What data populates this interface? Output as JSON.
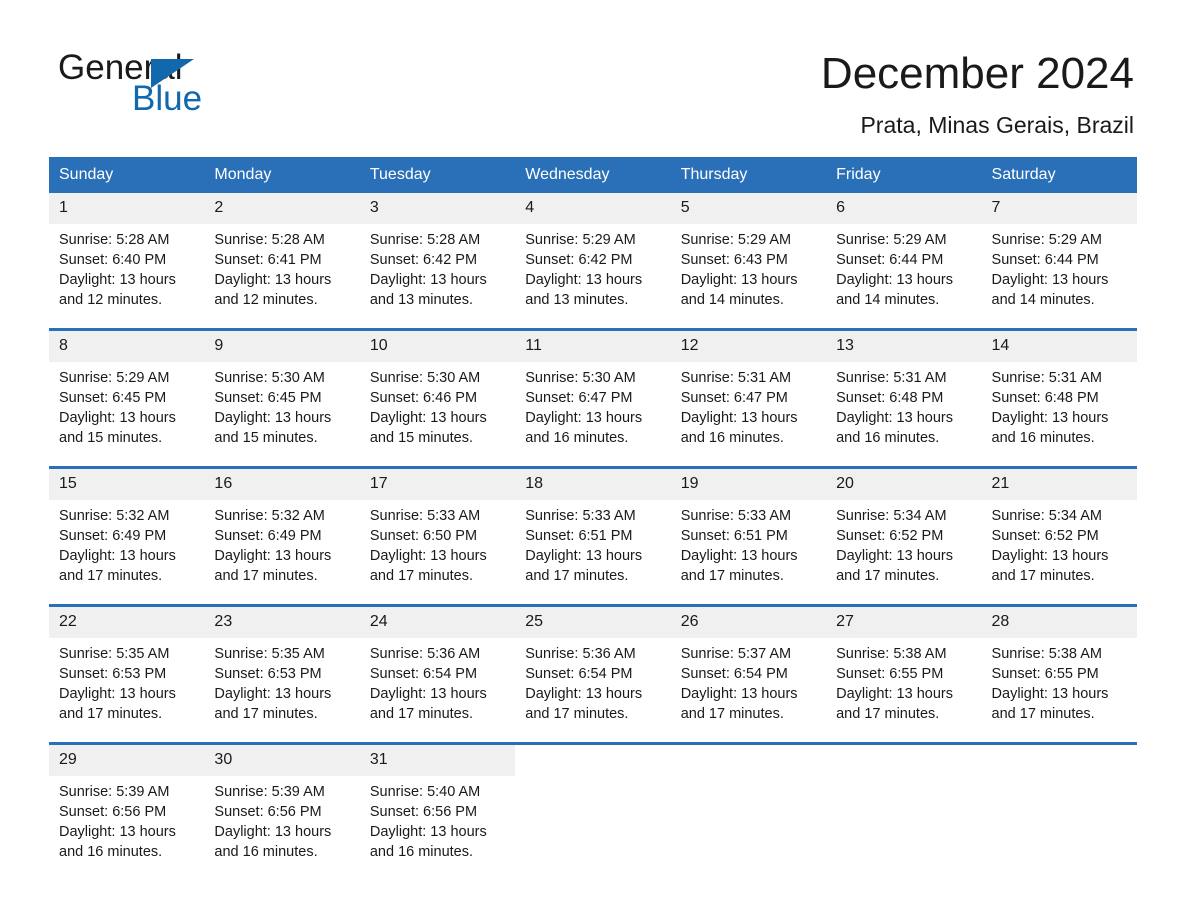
{
  "logo": {
    "word_one": "General",
    "word_two": "Blue",
    "triangle_icon": "triangle-icon",
    "brand_color": "#1168ad"
  },
  "header": {
    "month_title": "December 2024",
    "location": "Prata, Minas Gerais, Brazil"
  },
  "colors": {
    "header_blue": "#2a70b8",
    "daynum_band": "#f0f0f0",
    "text": "#1a1a1a"
  },
  "calendar": {
    "weekday_headers": [
      "Sunday",
      "Monday",
      "Tuesday",
      "Wednesday",
      "Thursday",
      "Friday",
      "Saturday"
    ],
    "weeks": [
      [
        {
          "day": "1",
          "sunrise": "Sunrise: 5:28 AM",
          "sunset": "Sunset: 6:40 PM",
          "daylight_1": "Daylight: 13 hours",
          "daylight_2": "and 12 minutes."
        },
        {
          "day": "2",
          "sunrise": "Sunrise: 5:28 AM",
          "sunset": "Sunset: 6:41 PM",
          "daylight_1": "Daylight: 13 hours",
          "daylight_2": "and 12 minutes."
        },
        {
          "day": "3",
          "sunrise": "Sunrise: 5:28 AM",
          "sunset": "Sunset: 6:42 PM",
          "daylight_1": "Daylight: 13 hours",
          "daylight_2": "and 13 minutes."
        },
        {
          "day": "4",
          "sunrise": "Sunrise: 5:29 AM",
          "sunset": "Sunset: 6:42 PM",
          "daylight_1": "Daylight: 13 hours",
          "daylight_2": "and 13 minutes."
        },
        {
          "day": "5",
          "sunrise": "Sunrise: 5:29 AM",
          "sunset": "Sunset: 6:43 PM",
          "daylight_1": "Daylight: 13 hours",
          "daylight_2": "and 14 minutes."
        },
        {
          "day": "6",
          "sunrise": "Sunrise: 5:29 AM",
          "sunset": "Sunset: 6:44 PM",
          "daylight_1": "Daylight: 13 hours",
          "daylight_2": "and 14 minutes."
        },
        {
          "day": "7",
          "sunrise": "Sunrise: 5:29 AM",
          "sunset": "Sunset: 6:44 PM",
          "daylight_1": "Daylight: 13 hours",
          "daylight_2": "and 14 minutes."
        }
      ],
      [
        {
          "day": "8",
          "sunrise": "Sunrise: 5:29 AM",
          "sunset": "Sunset: 6:45 PM",
          "daylight_1": "Daylight: 13 hours",
          "daylight_2": "and 15 minutes."
        },
        {
          "day": "9",
          "sunrise": "Sunrise: 5:30 AM",
          "sunset": "Sunset: 6:45 PM",
          "daylight_1": "Daylight: 13 hours",
          "daylight_2": "and 15 minutes."
        },
        {
          "day": "10",
          "sunrise": "Sunrise: 5:30 AM",
          "sunset": "Sunset: 6:46 PM",
          "daylight_1": "Daylight: 13 hours",
          "daylight_2": "and 15 minutes."
        },
        {
          "day": "11",
          "sunrise": "Sunrise: 5:30 AM",
          "sunset": "Sunset: 6:47 PM",
          "daylight_1": "Daylight: 13 hours",
          "daylight_2": "and 16 minutes."
        },
        {
          "day": "12",
          "sunrise": "Sunrise: 5:31 AM",
          "sunset": "Sunset: 6:47 PM",
          "daylight_1": "Daylight: 13 hours",
          "daylight_2": "and 16 minutes."
        },
        {
          "day": "13",
          "sunrise": "Sunrise: 5:31 AM",
          "sunset": "Sunset: 6:48 PM",
          "daylight_1": "Daylight: 13 hours",
          "daylight_2": "and 16 minutes."
        },
        {
          "day": "14",
          "sunrise": "Sunrise: 5:31 AM",
          "sunset": "Sunset: 6:48 PM",
          "daylight_1": "Daylight: 13 hours",
          "daylight_2": "and 16 minutes."
        }
      ],
      [
        {
          "day": "15",
          "sunrise": "Sunrise: 5:32 AM",
          "sunset": "Sunset: 6:49 PM",
          "daylight_1": "Daylight: 13 hours",
          "daylight_2": "and 17 minutes."
        },
        {
          "day": "16",
          "sunrise": "Sunrise: 5:32 AM",
          "sunset": "Sunset: 6:49 PM",
          "daylight_1": "Daylight: 13 hours",
          "daylight_2": "and 17 minutes."
        },
        {
          "day": "17",
          "sunrise": "Sunrise: 5:33 AM",
          "sunset": "Sunset: 6:50 PM",
          "daylight_1": "Daylight: 13 hours",
          "daylight_2": "and 17 minutes."
        },
        {
          "day": "18",
          "sunrise": "Sunrise: 5:33 AM",
          "sunset": "Sunset: 6:51 PM",
          "daylight_1": "Daylight: 13 hours",
          "daylight_2": "and 17 minutes."
        },
        {
          "day": "19",
          "sunrise": "Sunrise: 5:33 AM",
          "sunset": "Sunset: 6:51 PM",
          "daylight_1": "Daylight: 13 hours",
          "daylight_2": "and 17 minutes."
        },
        {
          "day": "20",
          "sunrise": "Sunrise: 5:34 AM",
          "sunset": "Sunset: 6:52 PM",
          "daylight_1": "Daylight: 13 hours",
          "daylight_2": "and 17 minutes."
        },
        {
          "day": "21",
          "sunrise": "Sunrise: 5:34 AM",
          "sunset": "Sunset: 6:52 PM",
          "daylight_1": "Daylight: 13 hours",
          "daylight_2": "and 17 minutes."
        }
      ],
      [
        {
          "day": "22",
          "sunrise": "Sunrise: 5:35 AM",
          "sunset": "Sunset: 6:53 PM",
          "daylight_1": "Daylight: 13 hours",
          "daylight_2": "and 17 minutes."
        },
        {
          "day": "23",
          "sunrise": "Sunrise: 5:35 AM",
          "sunset": "Sunset: 6:53 PM",
          "daylight_1": "Daylight: 13 hours",
          "daylight_2": "and 17 minutes."
        },
        {
          "day": "24",
          "sunrise": "Sunrise: 5:36 AM",
          "sunset": "Sunset: 6:54 PM",
          "daylight_1": "Daylight: 13 hours",
          "daylight_2": "and 17 minutes."
        },
        {
          "day": "25",
          "sunrise": "Sunrise: 5:36 AM",
          "sunset": "Sunset: 6:54 PM",
          "daylight_1": "Daylight: 13 hours",
          "daylight_2": "and 17 minutes."
        },
        {
          "day": "26",
          "sunrise": "Sunrise: 5:37 AM",
          "sunset": "Sunset: 6:54 PM",
          "daylight_1": "Daylight: 13 hours",
          "daylight_2": "and 17 minutes."
        },
        {
          "day": "27",
          "sunrise": "Sunrise: 5:38 AM",
          "sunset": "Sunset: 6:55 PM",
          "daylight_1": "Daylight: 13 hours",
          "daylight_2": "and 17 minutes."
        },
        {
          "day": "28",
          "sunrise": "Sunrise: 5:38 AM",
          "sunset": "Sunset: 6:55 PM",
          "daylight_1": "Daylight: 13 hours",
          "daylight_2": "and 17 minutes."
        }
      ],
      [
        {
          "day": "29",
          "sunrise": "Sunrise: 5:39 AM",
          "sunset": "Sunset: 6:56 PM",
          "daylight_1": "Daylight: 13 hours",
          "daylight_2": "and 16 minutes."
        },
        {
          "day": "30",
          "sunrise": "Sunrise: 5:39 AM",
          "sunset": "Sunset: 6:56 PM",
          "daylight_1": "Daylight: 13 hours",
          "daylight_2": "and 16 minutes."
        },
        {
          "day": "31",
          "sunrise": "Sunrise: 5:40 AM",
          "sunset": "Sunset: 6:56 PM",
          "daylight_1": "Daylight: 13 hours",
          "daylight_2": "and 16 minutes."
        },
        {
          "day": "",
          "sunrise": "",
          "sunset": "",
          "daylight_1": "",
          "daylight_2": ""
        },
        {
          "day": "",
          "sunrise": "",
          "sunset": "",
          "daylight_1": "",
          "daylight_2": ""
        },
        {
          "day": "",
          "sunrise": "",
          "sunset": "",
          "daylight_1": "",
          "daylight_2": ""
        },
        {
          "day": "",
          "sunrise": "",
          "sunset": "",
          "daylight_1": "",
          "daylight_2": ""
        }
      ]
    ]
  }
}
